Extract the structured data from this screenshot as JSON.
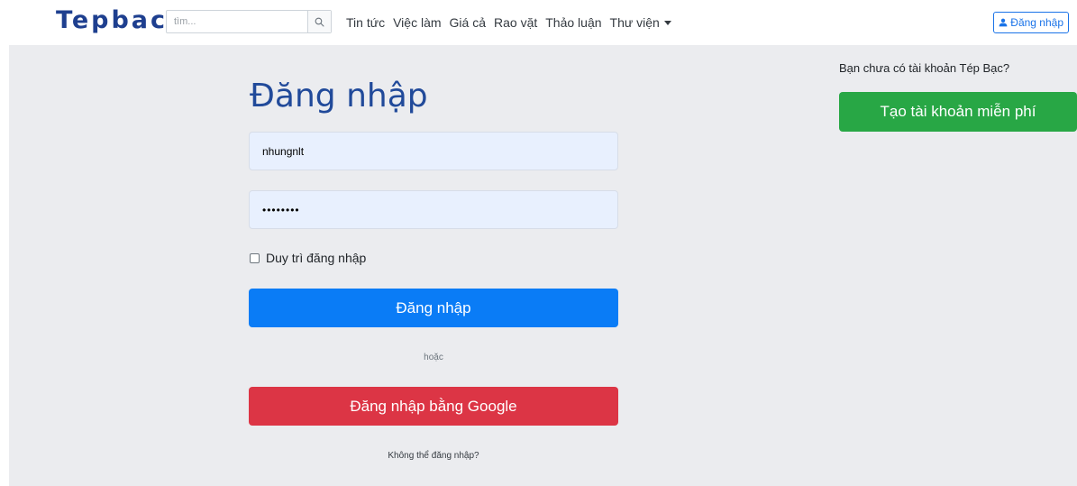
{
  "header": {
    "logo_text": "Tepbac",
    "search": {
      "placeholder": "tìm...",
      "value": ""
    },
    "nav": [
      {
        "label": "Tin tức"
      },
      {
        "label": "Việc làm"
      },
      {
        "label": "Giá cả"
      },
      {
        "label": "Rao vặt"
      },
      {
        "label": "Thảo luận"
      },
      {
        "label": "Thư viện",
        "has_dropdown": true
      }
    ],
    "login_button": "Đăng nhập",
    "icons": {
      "search": "search-icon",
      "user": "user-icon",
      "dropdown": "caret-down-icon"
    }
  },
  "form": {
    "title": "Đăng nhập",
    "username_value": "nhungnlt",
    "password_value": "••••••••",
    "remember_label": "Duy trì đăng nhập",
    "remember_checked": false,
    "login_button": "Đăng nhập",
    "or_text": "hoặc",
    "google_button": "Đăng nhập bằng Google",
    "cant_login": "Không thể đăng nhập?"
  },
  "side": {
    "prompt": "Bạn chưa có tài khoản Tép Bạc?",
    "signup_button": "Tạo tài khoản miễn phí"
  },
  "colors": {
    "brand": "#1e3f8f",
    "primary": "#0a7cf6",
    "danger": "#dc3545",
    "success": "#28a745",
    "background": "#ebecef",
    "input_fill": "#e8f0fe"
  }
}
